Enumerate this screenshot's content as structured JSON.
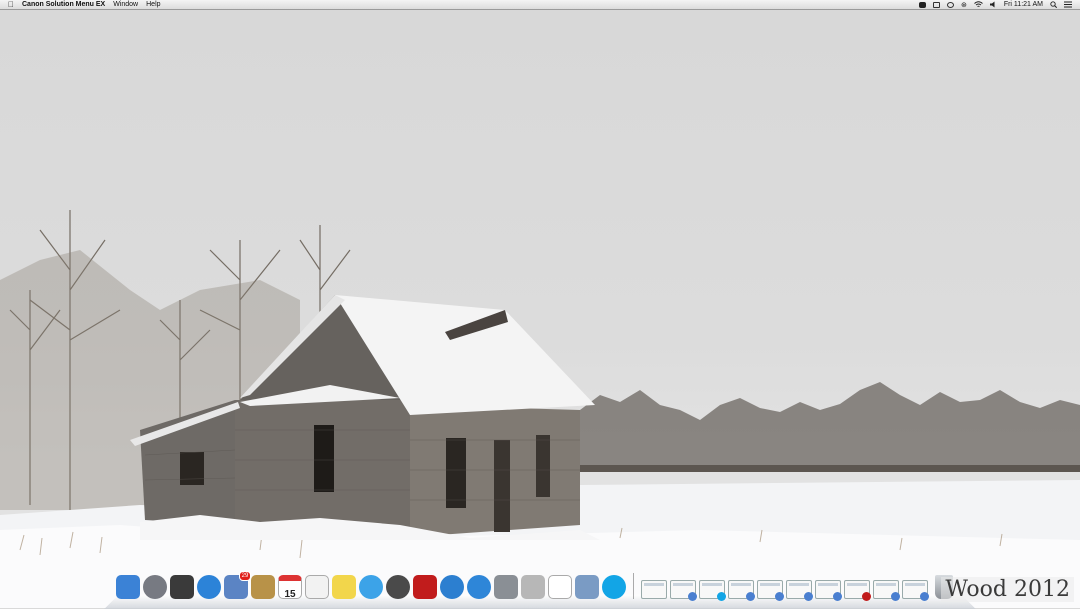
{
  "menubar": {
    "app_name": "Canon Solution Menu EX",
    "menus": [
      "Window",
      "Help"
    ],
    "status_icons": [
      "skype-status-icon",
      "airplay-icon",
      "time-machine-icon",
      "bluetooth-icon",
      "wifi-icon",
      "volume-icon"
    ],
    "clock": "Fri 11:21 AM"
  },
  "dock": {
    "apps": [
      {
        "name": "finder-icon",
        "color": "#3b82d6"
      },
      {
        "name": "launchpad-icon",
        "color": "#777a82"
      },
      {
        "name": "mission-control-icon",
        "color": "#3a3a3a"
      },
      {
        "name": "safari-icon",
        "color": "#2c83d8"
      },
      {
        "name": "mail-icon",
        "color": "#5b84c4",
        "badge": "29"
      },
      {
        "name": "contacts-icon",
        "color": "#b89248"
      },
      {
        "name": "calendar-icon",
        "color": "#ffffff",
        "date": "15"
      },
      {
        "name": "textedit-icon",
        "color": "#f2f2f2"
      },
      {
        "name": "stickies-icon",
        "color": "#f2d64b"
      },
      {
        "name": "messages-icon",
        "color": "#3ca3e8"
      },
      {
        "name": "facetime-icon",
        "color": "#4a4a4a"
      },
      {
        "name": "photo-booth-icon",
        "color": "#c11c1c"
      },
      {
        "name": "itunes-icon",
        "color": "#2c7fd0"
      },
      {
        "name": "app-store-icon",
        "color": "#2e86d8"
      },
      {
        "name": "automator-icon",
        "color": "#8a8f95"
      },
      {
        "name": "utility-icon",
        "color": "#b7b7b7"
      },
      {
        "name": "numbers-icon",
        "color": "#ffffff"
      },
      {
        "name": "iphoto-icon",
        "color": "#7a9bc4"
      },
      {
        "name": "skype-icon",
        "color": "#12a5e6"
      }
    ],
    "windows": [
      {
        "name": "document-icon",
        "sub": ""
      },
      {
        "name": "minimized-window-icon",
        "sub": "#4a7fd0"
      },
      {
        "name": "minimized-window-skype-icon",
        "sub": "#12a5e6"
      },
      {
        "name": "minimized-window-icon",
        "sub": "#4a7fd0"
      },
      {
        "name": "minimized-window-icon",
        "sub": "#4a7fd0"
      },
      {
        "name": "minimized-window-icon",
        "sub": "#4a7fd0"
      },
      {
        "name": "minimized-document-icon",
        "sub": "#4a7fd0"
      },
      {
        "name": "minimized-window-icon",
        "sub": "#c11c1c"
      },
      {
        "name": "minimized-window-icon",
        "sub": "#4a7fd0"
      },
      {
        "name": "minimized-window-icon",
        "sub": "#4a7fd0"
      }
    ],
    "trash": "trash-icon"
  },
  "watermark": "Wood 2012"
}
